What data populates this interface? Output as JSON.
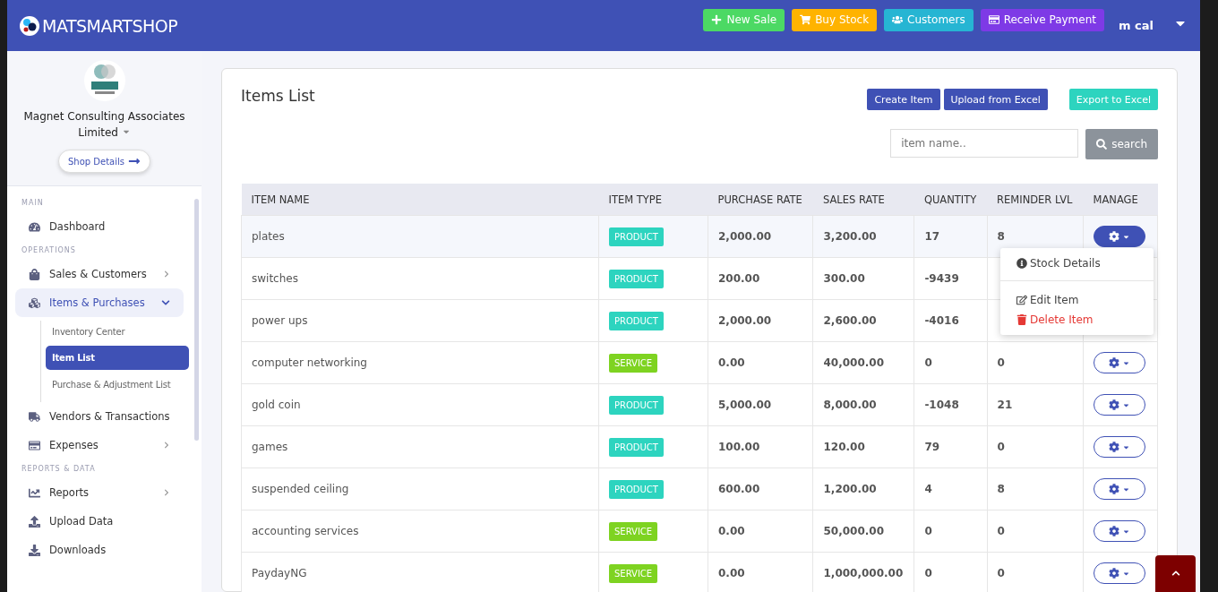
{
  "brand": "MATSMARTSHOP",
  "top_actions": [
    {
      "label": "New Sale",
      "kind": "sale"
    },
    {
      "label": "Buy Stock",
      "kind": "cart"
    },
    {
      "label": "Customers",
      "kind": "people"
    },
    {
      "label": "Receive Payment",
      "kind": "card"
    }
  ],
  "user": "m cal",
  "company": {
    "name": "Magnet Consulting Associates Limited",
    "button": "Shop Details"
  },
  "sidebar": [
    {
      "heading": "MAIN",
      "items": [
        {
          "label": "Dashboard",
          "selected": false
        }
      ]
    },
    {
      "heading": "OPERATIONS",
      "items": [
        {
          "label": "Sales & Customers",
          "expanded": false,
          "selected": false
        },
        {
          "label": "Items & Purchases",
          "expanded": true,
          "selected": true,
          "children": [
            {
              "label": "Inventory Center",
              "selected": false
            },
            {
              "label": "Item List",
              "selected": true
            },
            {
              "label": "Purchase & Adjustment List",
              "selected": false
            }
          ]
        },
        {
          "label": "Vendors & Transactions",
          "selected": false
        },
        {
          "label": "Expenses",
          "expanded": false,
          "selected": false
        }
      ]
    },
    {
      "heading": "REPORTS & DATA",
      "items": [
        {
          "label": "Reports",
          "expanded": false,
          "selected": false
        },
        {
          "label": "Upload Data",
          "selected": false
        },
        {
          "label": "Downloads",
          "selected": false
        }
      ]
    }
  ],
  "page_title": "Items List",
  "page_buttons": [
    {
      "label": "Create Item",
      "kind": "primary"
    },
    {
      "label": "Upload from Excel",
      "kind": "primary"
    },
    {
      "label": "Export to Excel",
      "kind": "accent"
    }
  ],
  "search": {
    "placeholder": "item name..",
    "button": "search"
  },
  "table": {
    "columns": [
      "ITEM NAME",
      "ITEM TYPE",
      "PURCHASE RATE",
      "SALES RATE",
      "QUANTITY",
      "REMINDER LVL",
      "MANAGE"
    ],
    "rows": [
      {
        "name": "plates",
        "type": "PRODUCT",
        "purchase": "2,000.00",
        "sales": "3,200.00",
        "quantity": "17",
        "reminder": "8",
        "menu_open": true
      },
      {
        "name": "switches",
        "type": "PRODUCT",
        "purchase": "200.00",
        "sales": "300.00",
        "quantity": "-9439"
      },
      {
        "name": "power ups",
        "type": "PRODUCT",
        "purchase": "2,000.00",
        "sales": "2,600.00",
        "quantity": "-4016"
      },
      {
        "name": "computer networking",
        "type": "SERVICE",
        "purchase": "0.00",
        "sales": "40,000.00",
        "quantity": "0",
        "reminder": "0",
        "menu_open": false
      },
      {
        "name": "gold coin",
        "type": "PRODUCT",
        "purchase": "5,000.00",
        "sales": "8,000.00",
        "quantity": "-1048",
        "reminder": "21",
        "menu_open": false
      },
      {
        "name": "games",
        "type": "PRODUCT",
        "purchase": "100.00",
        "sales": "120.00",
        "quantity": "79",
        "reminder": "0",
        "menu_open": false
      },
      {
        "name": "suspended ceiling",
        "type": "PRODUCT",
        "purchase": "600.00",
        "sales": "1,200.00",
        "quantity": "4",
        "reminder": "8",
        "menu_open": false
      },
      {
        "name": "accounting services",
        "type": "SERVICE",
        "purchase": "0.00",
        "sales": "50,000.00",
        "quantity": "0",
        "reminder": "0",
        "menu_open": false
      },
      {
        "name": "PaydayNG",
        "type": "SERVICE",
        "purchase": "0.00",
        "sales": "1,000,000.00",
        "quantity": "0",
        "reminder": "0",
        "menu_open": false
      }
    ]
  },
  "menu": [
    {
      "label": "Stock Details",
      "kind": "info"
    },
    {
      "label": "Edit Item",
      "kind": "edit"
    },
    {
      "label": "Delete Item",
      "kind": "delete"
    }
  ]
}
